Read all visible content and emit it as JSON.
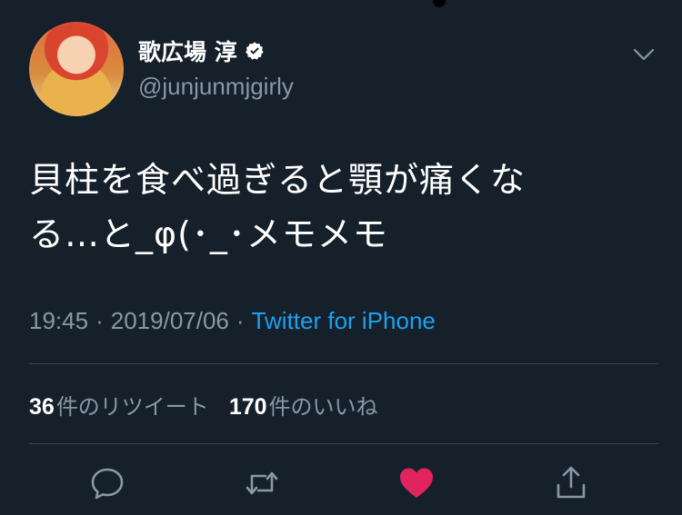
{
  "header": {
    "display_name": "歌広場 淳",
    "handle": "@junjunmjgirly",
    "verified_icon": "verified-badge-icon",
    "more_icon": "chevron-down-icon"
  },
  "tweet": {
    "text_line1": "貝柱を食べ過ぎると顎が痛くな",
    "text_line2": "る…と_φ(･_･メモメモ"
  },
  "meta": {
    "time": "19:45",
    "separator1": "·",
    "date": "2019/07/06",
    "separator2": "·",
    "source": "Twitter for iPhone"
  },
  "stats": {
    "retweets_count": "36",
    "retweets_label": "件のリツイート",
    "likes_count": "170",
    "likes_label": "件のいいね"
  },
  "actions": {
    "reply_icon": "reply-icon",
    "retweet_icon": "retweet-icon",
    "like_icon": "heart-icon",
    "share_icon": "share-icon"
  },
  "colors": {
    "background": "#15202b",
    "text_primary": "#ffffff",
    "text_secondary": "#8899a6",
    "link": "#1da1f2",
    "like": "#e0245e",
    "divider": "#38444d"
  }
}
